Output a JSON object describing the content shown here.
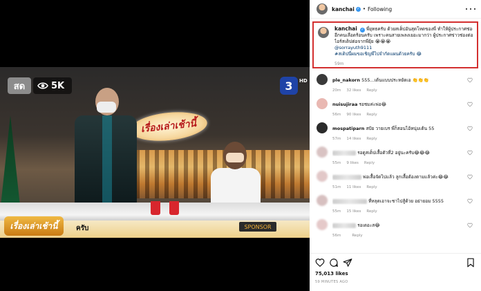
{
  "media": {
    "live_badge": "สด",
    "views": "5K",
    "channel_number": "3",
    "channel_hd": "HD",
    "show_logo_text": "เรื่องเล่าเช้านี้",
    "lower_logo_text": "เรื่องเล่าเช้านี้",
    "lower_caption": "ครับ",
    "sponsor_text": "SPONSOR"
  },
  "header": {
    "username": "kanchai",
    "separator": "•",
    "follow_label": "Following"
  },
  "caption": {
    "username": "kanchai",
    "lines": [
      "พี่ยุทธครับ ด้วยสเต็ปอันสุดโหดของพี่ ทำให้ผู้ประกาศช่องวัน",
      "อีกคนเลือดร้อนครับ เพราะคนสายเพลงเยอะมากว่า ผู้ประกาศข่าวช่องต่อไปจะ",
      "ไอร์สเต็ปต่อจากพี่ยุ้ย 😭😭😭"
    ],
    "mention": "@sorrayuth9111",
    "hashtag": "#สเต็ปนี้ผมขอเชิญพี่ไปจำกัดแผนด้วยครับ 😂",
    "time": "59m"
  },
  "comments": [
    {
      "user": "ple_nakorn",
      "text": " 555...เต้นแบบประหยัดเอ 👏👏👏",
      "time": "20m",
      "likes": "32 likes",
      "reply": "Reply",
      "blurred": false,
      "avatar_color": "#3a3a3a"
    },
    {
      "user": "nuisujiraa",
      "text": " รอชมค่ะพ่อ😂",
      "time": "56m",
      "likes": "90 likes",
      "reply": "Reply",
      "blurred": false,
      "avatar_color": "#e9b8b2"
    },
    {
      "user": "mospatiparn",
      "text": " สปัย วายเบร พี่ก็สอนไอ้หนุ่มเต้น 55",
      "time": "57m",
      "likes": "14 likes",
      "reply": "Reply",
      "blurred": false,
      "avatar_color": "#2b2b2b"
    },
    {
      "user": "",
      "text": " รอดูสเต็ปเสื้อตัวที่2 อยู่นะครับ😂😂😂",
      "time": "55m",
      "likes": "9 likes",
      "reply": "Reply",
      "blurred": true,
      "avatar_color": "#d9c3c3"
    },
    {
      "user": "",
      "text": " พ่อเสื้อจัดไปแล้ว ลูกเสื้อต้องตามแล้วค่ะ😂😂",
      "time": "51m",
      "likes": "11 likes",
      "reply": "Reply",
      "blurred": true,
      "avatar_color": "#e2c8c8"
    },
    {
      "user": "",
      "text": " ที่หลุดเอาจะชาไปสู้ด้วย อย่ายอม 5555",
      "time": "55m",
      "likes": "15 likes",
      "reply": "Reply",
      "blurred": true,
      "avatar_color": "#d7c0c0"
    },
    {
      "user": "",
      "text": " รอเดอะส😂",
      "time": "56m",
      "likes": "",
      "reply": "Reply",
      "blurred": true,
      "avatar_color": "#e5c9c9"
    }
  ],
  "footer": {
    "likes": "75,013 likes",
    "time_ago": "59 MINUTES AGO"
  }
}
